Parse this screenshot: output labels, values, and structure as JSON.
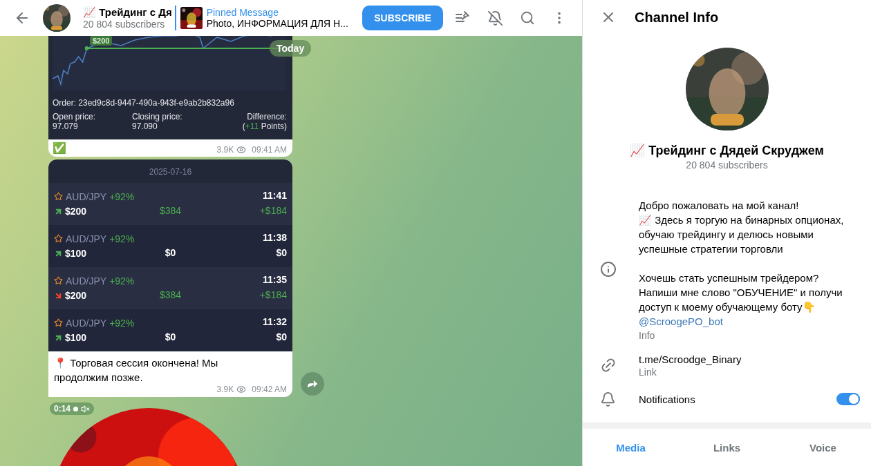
{
  "header": {
    "channel_name": "📈 Трейдинг с Дя",
    "subscribers": "20 804 subscribers",
    "pinned": {
      "title": "Pinned Message",
      "text": "Photo, ИНФОРМАЦИЯ ДЛЯ Н..."
    },
    "subscribe": "SUBSCRIBE"
  },
  "date_badge": "Today",
  "order_message": {
    "chart_label": "$200",
    "order": "Order: 23ed9c8d-9447-490a-943f-e9ab2b832a96",
    "open": {
      "label": "Open price:",
      "value": "97.079"
    },
    "close": {
      "label": "Closing price:",
      "value": "97.090"
    },
    "difference": {
      "label": "Difference:",
      "prefix": "(",
      "delta": "+11",
      "suffix": " Points)"
    },
    "caption": "✅",
    "views": "3.9K",
    "time": "09:41 AM"
  },
  "trades_message": {
    "date": "2025-07-16",
    "trades": [
      {
        "pair": "AUD/JPY",
        "payout": "+92%",
        "time": "11:41",
        "kind": "up",
        "amount": "$200",
        "result": "$384",
        "profit": "+$184",
        "won": true
      },
      {
        "pair": "AUD/JPY",
        "payout": "+92%",
        "time": "11:38",
        "kind": "up",
        "amount": "$100",
        "result": "$0",
        "profit": "$0",
        "won": false
      },
      {
        "pair": "AUD/JPY",
        "payout": "+92%",
        "time": "11:35",
        "kind": "down",
        "amount": "$200",
        "result": "$384",
        "profit": "+$184",
        "won": true
      },
      {
        "pair": "AUD/JPY",
        "payout": "+92%",
        "time": "11:32",
        "kind": "up",
        "amount": "$100",
        "result": "$0",
        "profit": "$0",
        "won": false
      }
    ],
    "text": "📍 Торговая сессия окончена! Мы продолжим позже.",
    "views": "3.9K",
    "time": "09:42 AM"
  },
  "video_message": {
    "duration": "0:14",
    "muted": true
  },
  "channel_info": {
    "title": "Channel Info",
    "name": "📈 Трейдинг с Дядей Скруджем",
    "subscribers": "20 804 subscribers",
    "description": "Добро пожаловать на мой канал!\n📈 Здесь я торгую на бинарных опционах, обучаю трейдингу и делюсь новыми успешные стратегии торговли\n\nХочешь стать успешным трейдером? Напиши мне слово \"ОБУЧЕНИЕ\" и получи доступ к моему обучающему боту👇",
    "bot_link": "@ScroogePO_bot",
    "info_label": "Info",
    "link": "t.me/Scroodge_Binary",
    "link_label": "Link",
    "notifications": {
      "label": "Notifications",
      "on": true
    },
    "tabs": [
      {
        "label": "Media",
        "selected": true
      },
      {
        "label": "Links",
        "selected": false
      },
      {
        "label": "Voice",
        "selected": false
      }
    ]
  }
}
